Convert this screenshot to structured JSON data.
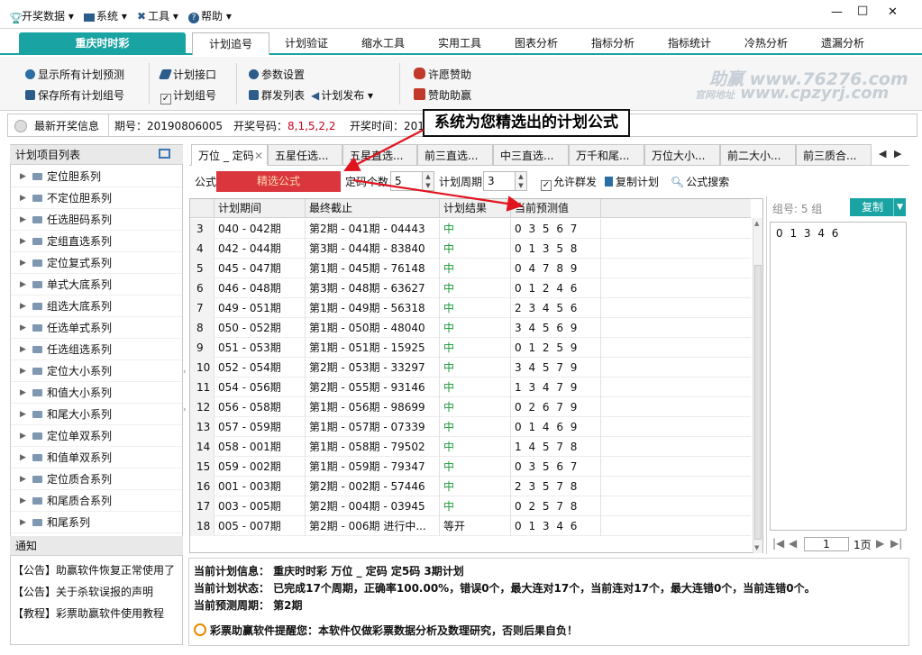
{
  "menu": {
    "items": [
      {
        "label": "开奖数据 ▾"
      },
      {
        "label": "系统 ▾"
      },
      {
        "label": "工具 ▾"
      },
      {
        "label": "帮助 ▾"
      }
    ],
    "window_controls": {
      "minimize": "—",
      "maximize": "□",
      "close": "✕"
    }
  },
  "app_tab": "重庆时时彩",
  "main_tabs": [
    "计划追号",
    "计划验证",
    "缩水工具",
    "实用工具",
    "图表分析",
    "指标分析",
    "指标统计",
    "冷热分析",
    "遗漏分析"
  ],
  "toolbar": {
    "show_all_predictions": "显示所有计划预测",
    "save_all_groups": "保存所有计划组号",
    "plan_interface": "计划接口",
    "plan_group": "计划组号",
    "param_settings": "参数设置",
    "group_list": "群发列表",
    "plan_publish": "计划发布 ▾",
    "wish_donate": "许愿赞助",
    "sponsor": "赞助助赢"
  },
  "watermark": {
    "line1_brand": "助赢",
    "line1_url": "www.76276.com",
    "line2_label": "官网地址",
    "line2_url": "www.cpzyrj.com"
  },
  "infobar": {
    "toggle_label": "最新开奖信息",
    "issue_label": "期号：",
    "issue_value": "20190806005",
    "draw_label": "开奖号码：",
    "draw_value": "8,1,5,2,2",
    "time_label": "开奖时间：",
    "time_value": "201"
  },
  "callout": "系统为您精选出的计划公式",
  "sidebar": {
    "title": "计划项目列表",
    "items": [
      "定位胆系列",
      "不定位胆系列",
      "任选胆码系列",
      "定组直选系列",
      "定位复式系列",
      "单式大底系列",
      "组选大底系列",
      "任选单式系列",
      "任选组选系列",
      "定位大小系列",
      "和值大小系列",
      "和尾大小系列",
      "定位单双系列",
      "和值单双系列",
      "定位质合系列",
      "和尾质合系列",
      "和尾系列"
    ],
    "notice_title": "通知",
    "notices": [
      "【公告】助赢软件恢复正常使用了",
      "【公告】关于杀软误报的声明",
      "【教程】彩票助赢软件使用教程"
    ]
  },
  "content_tabs": [
    "万位 _ 定码",
    "五星任选...",
    "五星直选...",
    "前三直选...",
    "中三直选...",
    "万千和尾...",
    "万位大小...",
    "前二大小...",
    "前三质合..."
  ],
  "formula": {
    "label": "公式",
    "selected": "精选公式",
    "count_label": "定码个数",
    "count_value": "5",
    "period_label": "计划周期",
    "period_value": "3",
    "allow_group_send": "允许群发",
    "copy_plan": "复制计划",
    "formula_search": "公式搜索"
  },
  "table": {
    "headers": [
      "计划期间",
      "最终截止",
      "计划结果",
      "当前预测值"
    ],
    "rows": [
      [
        "3",
        "040 - 042期",
        "第2期 - 041期 - 04443",
        "中",
        "0 3 5 6 7"
      ],
      [
        "4",
        "042 - 044期",
        "第3期 - 044期 - 83840",
        "中",
        "0 1 3 5 8"
      ],
      [
        "5",
        "045 - 047期",
        "第1期 - 045期 - 76148",
        "中",
        "0 4 7 8 9"
      ],
      [
        "6",
        "046 - 048期",
        "第3期 - 048期 - 63627",
        "中",
        "0 1 2 4 6"
      ],
      [
        "7",
        "049 - 051期",
        "第1期 - 049期 - 56318",
        "中",
        "2 3 4 5 6"
      ],
      [
        "8",
        "050 - 052期",
        "第1期 - 050期 - 48040",
        "中",
        "3 4 5 6 9"
      ],
      [
        "9",
        "051 - 053期",
        "第1期 - 051期 - 15925",
        "中",
        "0 1 2 5 9"
      ],
      [
        "10",
        "052 - 054期",
        "第2期 - 053期 - 33297",
        "中",
        "3 4 5 7 9"
      ],
      [
        "11",
        "054 - 056期",
        "第2期 - 055期 - 93146",
        "中",
        "1 3 4 7 9"
      ],
      [
        "12",
        "056 - 058期",
        "第1期 - 056期 - 98699",
        "中",
        "0 2 6 7 9"
      ],
      [
        "13",
        "057 - 059期",
        "第1期 - 057期 - 07339",
        "中",
        "0 1 4 6 9"
      ],
      [
        "14",
        "058 - 001期",
        "第1期 - 058期 - 79502",
        "中",
        "1 4 5 7 8"
      ],
      [
        "15",
        "059 - 002期",
        "第1期 - 059期 - 79347",
        "中",
        "0 3 5 6 7"
      ],
      [
        "16",
        "001 - 003期",
        "第2期 - 002期 - 57446",
        "中",
        "2 3 5 7 8"
      ],
      [
        "17",
        "003 - 005期",
        "第2期 - 004期 - 03945",
        "中",
        "0 2 5 7 8"
      ],
      [
        "18",
        "005 - 007期",
        "第2期 - 006期 进行中...",
        "等开",
        "0 1 3 4 6"
      ]
    ]
  },
  "right_panel": {
    "group_label": "组号: 5 组",
    "copy_label": "复制",
    "result": "0 1 3 4 6",
    "page_value": "1",
    "page_total": "1页"
  },
  "status": {
    "line1": "当前计划信息：  重庆时时彩    万位 _ 定码    定5码    3期计划",
    "line2": "当前计划状态：  已完成17个周期，正确率100.00%，错误0个，最大连对17个，当前连对17个，最大连错0个，当前连错0个。",
    "line3": "当前预测周期：  第2期",
    "warning": "彩票助赢软件提醒您：本软件仅做彩票数据分析及数理研究，否则后果自负！"
  },
  "colors": {
    "teal": "#1aa3a3",
    "red": "#d9363e",
    "hit_green": "#169a34",
    "draw_red": "#d0021b"
  }
}
